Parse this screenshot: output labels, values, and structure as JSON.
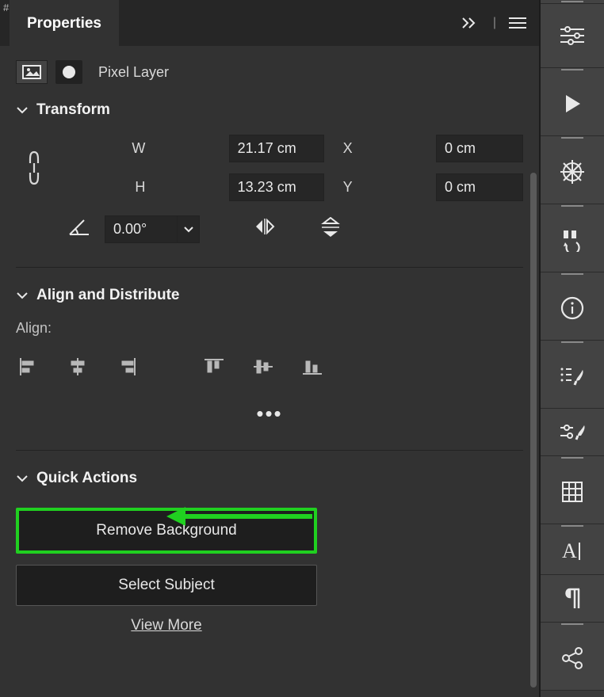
{
  "panel": {
    "title": "Properties",
    "layer_type": "Pixel Layer"
  },
  "transform": {
    "header": "Transform",
    "labels": {
      "w": "W",
      "h": "H",
      "x": "X",
      "y": "Y"
    },
    "w": "21.17 cm",
    "h": "13.23 cm",
    "x": "0 cm",
    "y": "0 cm",
    "angle": "0.00°"
  },
  "align_section": {
    "header": "Align and Distribute",
    "sub": "Align:"
  },
  "quick_actions": {
    "header": "Quick Actions",
    "remove_bg": "Remove Background",
    "select_subject": "Select Subject",
    "view_more": "View More"
  }
}
